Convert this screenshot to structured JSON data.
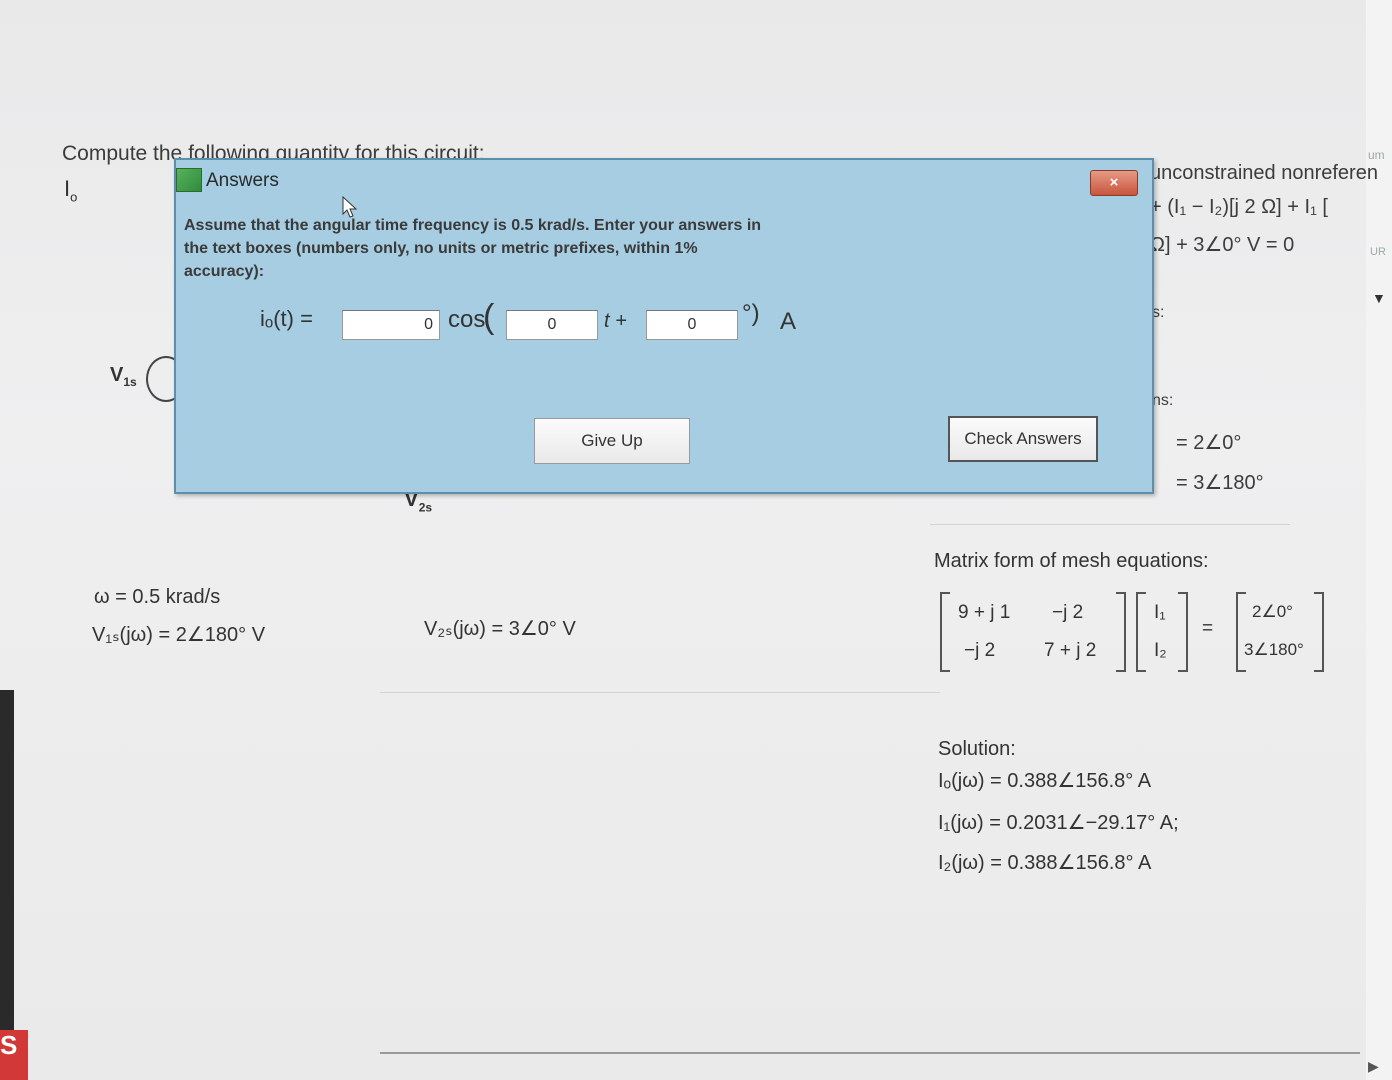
{
  "page": {
    "title": "Compute the following quantity for this circuit:",
    "quantity_label": "I",
    "quantity_sub": "o",
    "right_lines": [
      "unconstrained nonreferen",
      "+ (I₁ − I₂)[j 2 Ω] + I₁ [",
      "Ω] + 3∠0° V = 0"
    ],
    "right_partial_1": "s:",
    "right_partial_2": "ns:",
    "eq_right_1": "= 2∠0°",
    "eq_right_2": "= 3∠180°",
    "source1": "V",
    "source1_sub": "1s",
    "source2": "V",
    "source2_sub": "2s",
    "omega": "ω = 0.5 krad/s",
    "v1s_eq": "V₁ₛ(jω) = 2∠180° V",
    "v2s_eq": "V₂ₛ(jω) = 3∠0° V",
    "matrix_title": "Matrix form of mesh equations:",
    "matrix": {
      "a11": "9 + j 1",
      "a12": "−j 2",
      "a21": "−j 2",
      "a22": "7 + j 2",
      "x1": "I₁",
      "x2": "I₂",
      "b1": "2∠0°",
      "b2": "3∠180°",
      "equals": "="
    },
    "solution_title": "Solution:",
    "solutions": [
      "Iₒ(jω) = 0.388∠156.8° A",
      "I₁(jω) = 0.2031∠−29.17° A;",
      "I₂(jω) = 0.388∠156.8° A"
    ],
    "right_tab_1": "um",
    "right_tab_2": "UR",
    "left_red_badge": "S"
  },
  "dialog": {
    "title": "Answers",
    "close_label": "×",
    "instructions": "Assume that the angular time frequency is 0.5 krad/s. Enter your answers in the text boxes (numbers only, no units or metric prefixes, within 1% accuracy):",
    "equation_label": "iₒ(t) =",
    "cos_label": "cos",
    "t_plus_label": "t +",
    "degree_close": "°)",
    "unit_label": "A",
    "amplitude_value": "0",
    "omega_value": "0",
    "phase_value": "0",
    "give_up_label": "Give Up",
    "check_label": "Check Answers"
  }
}
